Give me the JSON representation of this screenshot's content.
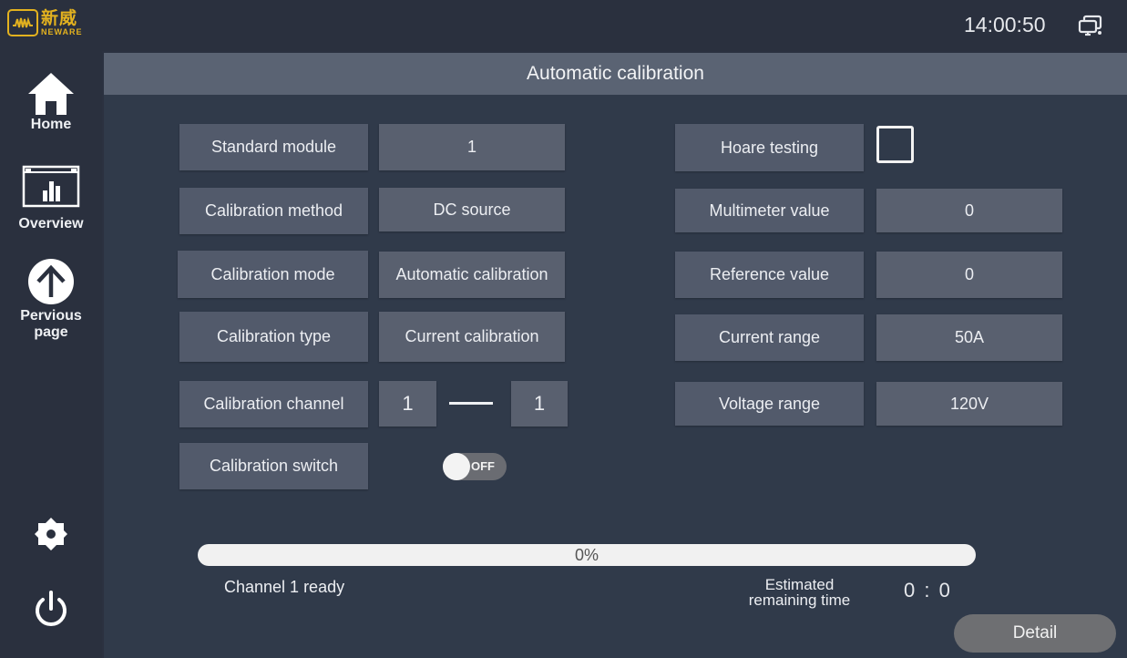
{
  "brand": {
    "name_cn": "新威",
    "name_en": "NEWARE",
    "color": "#e3b21f"
  },
  "topbar": {
    "clock": "14:00:50",
    "screen_icon": "screen-switch-icon"
  },
  "sidebar": {
    "items": [
      {
        "label": "Home",
        "icon": "home-icon"
      },
      {
        "label": "Overview",
        "icon": "overview-chart-icon"
      },
      {
        "label": "Pervious page",
        "label_line1": "Pervious",
        "label_line2": "page",
        "icon": "arrow-up-circle-icon"
      }
    ],
    "bottom": [
      {
        "icon": "gear-icon"
      },
      {
        "icon": "power-icon"
      }
    ]
  },
  "page": {
    "title": "Automatic calibration"
  },
  "left_fields": [
    {
      "label": "Standard module",
      "value": "1"
    },
    {
      "label": "Calibration method",
      "value": "DC source"
    },
    {
      "label": "Calibration mode",
      "value": "Automatic calibration"
    },
    {
      "label": "Calibration type",
      "value": "Current calibration"
    },
    {
      "label": "Calibration channel",
      "from": "1",
      "to": "1"
    },
    {
      "label": "Calibration switch",
      "toggle_state": "OFF"
    }
  ],
  "right_fields": [
    {
      "label": "Hoare  testing",
      "checked": false
    },
    {
      "label": "Multimeter value",
      "value": "0"
    },
    {
      "label": "Reference value",
      "value": "0"
    },
    {
      "label": "Current range",
      "value": "50A"
    },
    {
      "label": "Voltage range",
      "value": "120V"
    }
  ],
  "progress": {
    "percent": 0,
    "text": "0%"
  },
  "status": {
    "text": "Channel 1 ready"
  },
  "estimate": {
    "label_line1": "Estimated",
    "label_line2": "remaining time",
    "value": "0 : 0"
  },
  "detail_button": {
    "label": "Detail"
  }
}
